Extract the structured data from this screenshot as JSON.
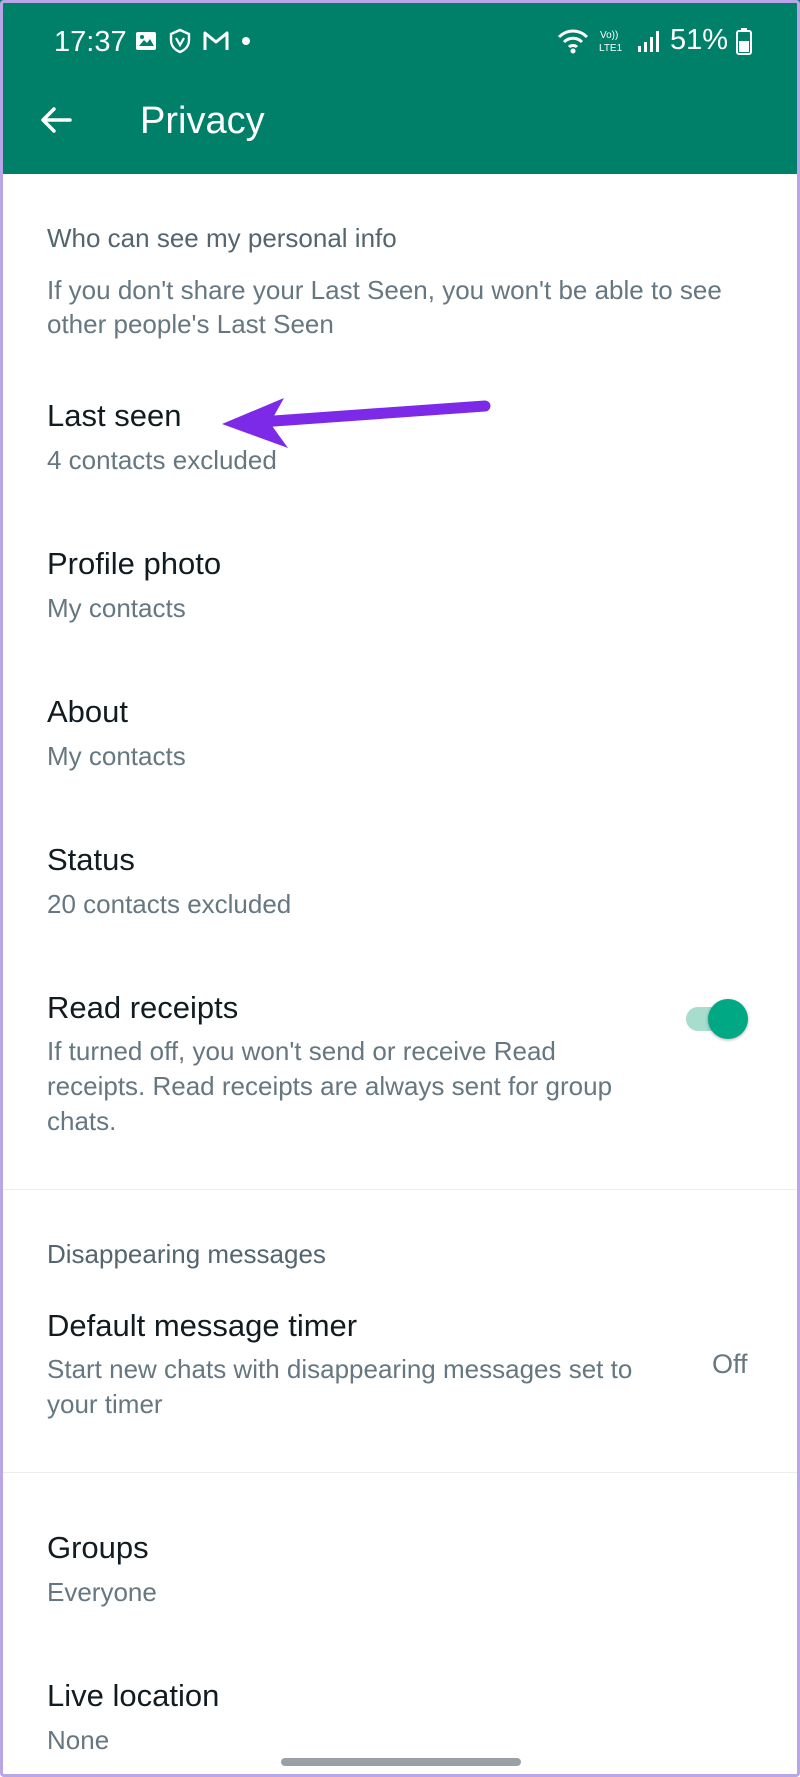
{
  "status_bar": {
    "time": "17:37",
    "battery": "51%",
    "network": "LTE1",
    "volte": "Vo))"
  },
  "toolbar": {
    "title": "Privacy"
  },
  "personal_info": {
    "heading": "Who can see my personal info",
    "description": "If you don't share your Last Seen, you won't be able to see other people's Last Seen",
    "items": [
      {
        "title": "Last seen",
        "subtitle": "4 contacts excluded"
      },
      {
        "title": "Profile photo",
        "subtitle": "My contacts"
      },
      {
        "title": "About",
        "subtitle": "My contacts"
      },
      {
        "title": "Status",
        "subtitle": "20 contacts excluded"
      }
    ],
    "read_receipts": {
      "title": "Read receipts",
      "description": "If turned off, you won't send or receive Read receipts. Read receipts are always sent for group chats.",
      "enabled": true
    }
  },
  "disappearing": {
    "heading": "Disappearing messages",
    "timer_title": "Default message timer",
    "timer_description": "Start new chats with disappearing messages set to your timer",
    "timer_value": "Off"
  },
  "more": {
    "items": [
      {
        "title": "Groups",
        "subtitle": "Everyone"
      },
      {
        "title": "Live location",
        "subtitle": "None"
      }
    ]
  },
  "colors": {
    "brand": "#008069",
    "accent": "#00a884",
    "annotation_arrow": "#7c2ae8"
  },
  "icons": {
    "back": "arrow-left-icon",
    "gallery": "image-icon",
    "shield": "shield-icon",
    "gmail": "gmail-icon",
    "wifi": "wifi-icon",
    "signal": "signal-icon",
    "battery": "battery-icon"
  }
}
